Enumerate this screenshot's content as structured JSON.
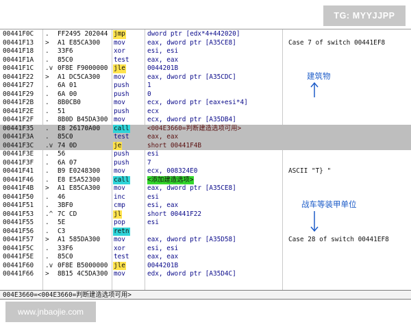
{
  "badges": {
    "tg": "TG: MYYJJPP",
    "site": "www.jnbaojie.com"
  },
  "status_bar": {
    "text": "004E3660=<004E3660=判断建造选项可用>"
  },
  "annotations": {
    "building": "建筑物",
    "armor": "战车等装甲单位"
  },
  "colors": {
    "jmp_highlight": "#ffe34d",
    "call_highlight": "#2fd4d8",
    "operand_highlight": "#34d62c",
    "selection": "#bebebe",
    "annotation": "#1d5cc8"
  },
  "rows": [
    {
      "addr": "00441F0C",
      "mark": ".",
      "hex": "FF2495 202044",
      "mnem": "jmp",
      "mnem_style": "jmp",
      "oper": "dword ptr [edx*4+442020]",
      "cmt": ""
    },
    {
      "addr": "00441F13",
      "mark": ">",
      "hex": "A1 E85CA300",
      "mnem": "mov",
      "mnem_style": "",
      "oper": "eax, dword ptr [A35CE8]",
      "cmt": "Case 7 of switch 00441EF8"
    },
    {
      "addr": "00441F18",
      "mark": ".",
      "hex": "33F6",
      "mnem": "xor",
      "mnem_style": "",
      "oper": "esi, esi",
      "cmt": ""
    },
    {
      "addr": "00441F1A",
      "mark": ".",
      "hex": "85C0",
      "mnem": "test",
      "mnem_style": "",
      "oper": "eax, eax",
      "cmt": ""
    },
    {
      "addr": "00441F1C",
      "mark": ".v",
      "hex": "0F8E F9000000",
      "mnem": "jle",
      "mnem_style": "jmp",
      "oper": "0044201B",
      "cmt": ""
    },
    {
      "addr": "00441F22",
      "mark": ">",
      "hex": "A1 DC5CA300",
      "mnem": "mov",
      "mnem_style": "",
      "oper": "eax, dword ptr [A35CDC]",
      "cmt": ""
    },
    {
      "addr": "00441F27",
      "mark": ".",
      "hex": "6A 01",
      "mnem": "push",
      "mnem_style": "",
      "oper": "1",
      "cmt": ""
    },
    {
      "addr": "00441F29",
      "mark": ".",
      "hex": "6A 00",
      "mnem": "push",
      "mnem_style": "",
      "oper": "0",
      "cmt": ""
    },
    {
      "addr": "00441F2B",
      "mark": ".",
      "hex": "8B0CB0",
      "mnem": "mov",
      "mnem_style": "",
      "oper": "ecx, dword ptr [eax+esi*4]",
      "cmt": ""
    },
    {
      "addr": "00441F2E",
      "mark": ".",
      "hex": "51",
      "mnem": "push",
      "mnem_style": "",
      "oper": "ecx",
      "cmt": ""
    },
    {
      "addr": "00441F2F",
      "mark": ".",
      "hex": "8B0D B45DA300",
      "mnem": "mov",
      "mnem_style": "",
      "oper": "ecx, dword ptr [A35DB4]",
      "cmt": ""
    },
    {
      "addr": "00441F35",
      "mark": ".",
      "hex": "E8 26170A00",
      "mnem": "call",
      "mnem_style": "call",
      "oper": "<004E3660=判断建造选项可用>",
      "oper_style": "",
      "cmt": "",
      "selected": true
    },
    {
      "addr": "00441F3A",
      "mark": ".",
      "hex": "85C0",
      "mnem": "test",
      "mnem_style": "",
      "oper": "eax, eax",
      "cmt": "",
      "selected": true
    },
    {
      "addr": "00441F3C",
      "mark": ".v",
      "hex": "74 0D",
      "mnem": "je",
      "mnem_style": "jmp",
      "oper": "short 00441F4B",
      "cmt": "",
      "selected": true
    },
    {
      "addr": "00441F3E",
      "mark": ".",
      "hex": "56",
      "mnem": "push",
      "mnem_style": "",
      "oper": "esi",
      "cmt": ""
    },
    {
      "addr": "00441F3F",
      "mark": ".",
      "hex": "6A 07",
      "mnem": "push",
      "mnem_style": "",
      "oper": "7",
      "cmt": ""
    },
    {
      "addr": "00441F41",
      "mark": ".",
      "hex": "B9 E0248300",
      "mnem": "mov",
      "mnem_style": "",
      "oper": "ecx, 008324E0",
      "cmt": "ASCII \"T} \""
    },
    {
      "addr": "00441F46",
      "mark": ".",
      "hex": "E8 E5A52300",
      "mnem": "call",
      "mnem_style": "call",
      "oper": "<添加建造选项>",
      "oper_style": "hl",
      "cmt": ""
    },
    {
      "addr": "00441F4B",
      "mark": ">",
      "hex": "A1 E85CA300",
      "mnem": "mov",
      "mnem_style": "",
      "oper": "eax, dword ptr [A35CE8]",
      "cmt": ""
    },
    {
      "addr": "00441F50",
      "mark": ".",
      "hex": "46",
      "mnem": "inc",
      "mnem_style": "",
      "oper": "esi",
      "cmt": ""
    },
    {
      "addr": "00441F51",
      "mark": ".",
      "hex": "3BF0",
      "mnem": "cmp",
      "mnem_style": "",
      "oper": "esi, eax",
      "cmt": ""
    },
    {
      "addr": "00441F53",
      "mark": ".^",
      "hex": "7C CD",
      "mnem": "jl",
      "mnem_style": "jmp",
      "oper": "short 00441F22",
      "cmt": ""
    },
    {
      "addr": "00441F55",
      "mark": ".",
      "hex": "5E",
      "mnem": "pop",
      "mnem_style": "",
      "oper": "esi",
      "cmt": ""
    },
    {
      "addr": "00441F56",
      "mark": ".",
      "hex": "C3",
      "mnem": "retn",
      "mnem_style": "call",
      "oper": "",
      "cmt": ""
    },
    {
      "addr": "00441F57",
      "mark": ">",
      "hex": "A1 585DA300",
      "mnem": "mov",
      "mnem_style": "",
      "oper": "eax, dword ptr [A35D58]",
      "cmt": "Case 28 of switch 00441EF8"
    },
    {
      "addr": "00441F5C",
      "mark": ".",
      "hex": "33F6",
      "mnem": "xor",
      "mnem_style": "",
      "oper": "esi, esi",
      "cmt": ""
    },
    {
      "addr": "00441F5E",
      "mark": ".",
      "hex": "85C0",
      "mnem": "test",
      "mnem_style": "",
      "oper": "eax, eax",
      "cmt": ""
    },
    {
      "addr": "00441F60",
      "mark": ".v",
      "hex": "0F8E B5000000",
      "mnem": "jle",
      "mnem_style": "jmp",
      "oper": "0044201B",
      "cmt": ""
    },
    {
      "addr": "00441F66",
      "mark": ">",
      "hex": "8B15 4C5DA300",
      "mnem": "mov",
      "mnem_style": "",
      "oper": "edx, dword ptr [A35D4C]",
      "cmt": ""
    }
  ]
}
